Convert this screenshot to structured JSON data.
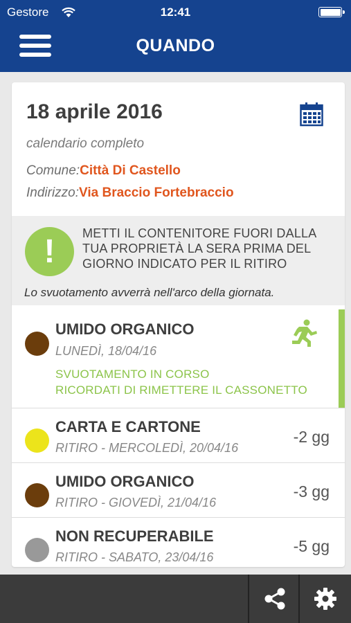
{
  "status_bar": {
    "carrier": "Gestore",
    "time": "12:41"
  },
  "nav": {
    "title": "QUANDO"
  },
  "header": {
    "date": "18 aprile 2016",
    "calendar_link": "calendario completo",
    "comune_label": "Comune:",
    "comune_value": "Città Di Castello",
    "indirizzo_label": "Indirizzo:",
    "indirizzo_value": "Via Braccio Fortebraccio"
  },
  "notice": {
    "badge": "!",
    "lines": [
      "METTI IL CONTENITORE FUORI DALLA",
      "TUA PROPRIETÀ LA SERA PRIMA DEL",
      "GIORNO INDICATO PER IL RITIRO"
    ],
    "subtext": "Lo svuotamento avverrà nell'arco della giornata."
  },
  "current_pickup": {
    "name": "UMIDO ORGANICO",
    "date": "LUNEDÌ, 18/04/16",
    "status_line_1": "SVUOTAMENTO IN CORSO",
    "status_line_2": "RICORDATI DI RIMETTERE IL CASSONETTO",
    "dot_color": "#6b3d0c",
    "icon": "running-man-icon"
  },
  "upcoming": [
    {
      "name": "CARTA E CARTONE",
      "date": "RITIRO - MERCOLEDÌ, 20/04/16",
      "days": "-2 gg",
      "dot_color": "#ece41b"
    },
    {
      "name": "UMIDO ORGANICO",
      "date": "RITIRO - GIOVEDÌ, 21/04/16",
      "days": "-3 gg",
      "dot_color": "#6b3d0c"
    },
    {
      "name": "NON RECUPERABILE",
      "date": "RITIRO - SABATO, 23/04/16",
      "days": "-5 gg",
      "dot_color": "#999999"
    }
  ],
  "toolbar": {
    "icons": [
      "share-icon",
      "settings-icon"
    ]
  },
  "colors": {
    "nav_bg": "#15438f",
    "accent_orange": "#e0561e",
    "accent_green": "#9bcc56",
    "toolbar_bg": "#3b3b3b"
  }
}
